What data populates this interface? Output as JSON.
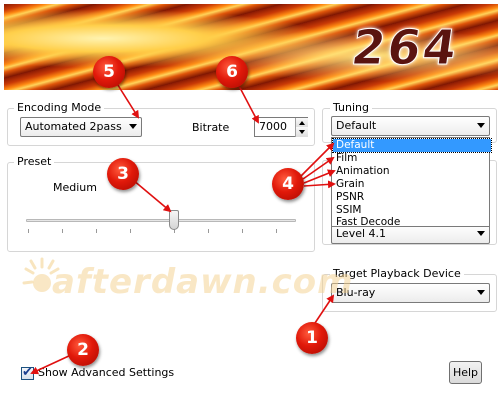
{
  "banner": {
    "title": "264"
  },
  "encoding_mode": {
    "group_label": "Encoding Mode",
    "selected": "Automated 2pass",
    "bitrate_label": "Bitrate",
    "bitrate_value": "7000"
  },
  "preset": {
    "group_label": "Preset",
    "value_label": "Medium"
  },
  "tuning": {
    "group_label": "Tuning",
    "selected": "Default",
    "options": [
      "Default",
      "Film",
      "Animation",
      "Grain",
      "PSNR",
      "SSIM",
      "Fast Decode"
    ]
  },
  "level": {
    "selected": "Level 4.1"
  },
  "target_device": {
    "group_label": "Target Playback Device",
    "selected": "Blu-ray"
  },
  "watermark": {
    "text": "afterdawn.com"
  },
  "footer": {
    "advanced_label": "Show Advanced Settings",
    "advanced_checked": true,
    "help_label": "Help"
  },
  "annotations": [
    "1",
    "2",
    "3",
    "4",
    "5",
    "6"
  ],
  "colors": {
    "badge": "#e1190a",
    "selection": "#3399ff",
    "arrow": "#e01010"
  }
}
